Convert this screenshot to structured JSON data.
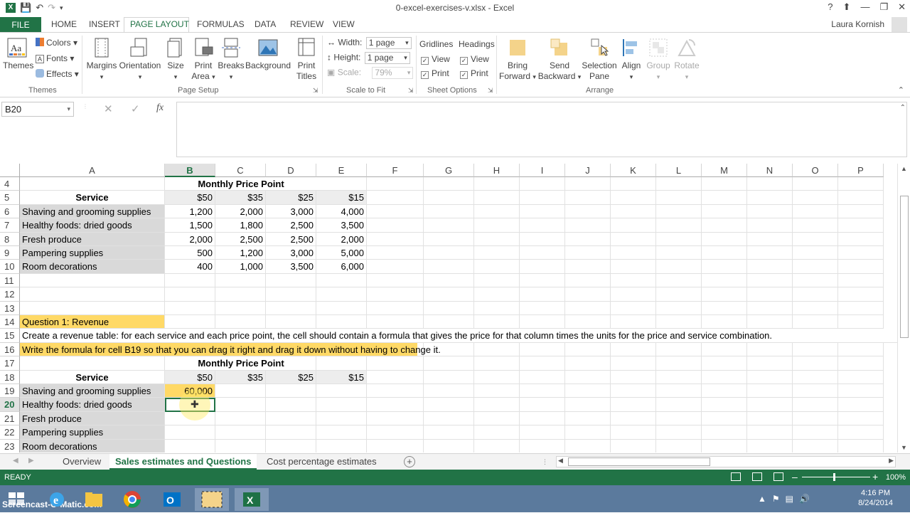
{
  "window": {
    "title": "0-excel-exercises-v.xlsx - Excel",
    "help": "?",
    "user": "Laura Kornish"
  },
  "ribbon_tabs": [
    "FILE",
    "HOME",
    "INSERT",
    "PAGE LAYOUT",
    "FORMULAS",
    "DATA",
    "REVIEW",
    "VIEW"
  ],
  "ribbon": {
    "themes": {
      "themes": "Themes",
      "colors": "Colors",
      "fonts": "Fonts",
      "effects": "Effects",
      "group": "Themes"
    },
    "page_setup": {
      "margins": "Margins",
      "orientation": "Orientation",
      "size": "Size",
      "print_area_1": "Print",
      "print_area_2": "Area",
      "breaks": "Breaks",
      "background": "Background",
      "print_titles_1": "Print",
      "print_titles_2": "Titles",
      "group": "Page Setup"
    },
    "scale_to_fit": {
      "width_label": "Width:",
      "width_value": "1 page",
      "height_label": "Height:",
      "height_value": "1 page",
      "scale_label": "Scale:",
      "scale_value": "79%",
      "group": "Scale to Fit"
    },
    "sheet_options": {
      "gridlines": "Gridlines",
      "headings": "Headings",
      "view": "View",
      "print": "Print",
      "group": "Sheet Options"
    },
    "arrange": {
      "bring_1": "Bring",
      "bring_2": "Forward",
      "send_1": "Send",
      "send_2": "Backward",
      "selection_1": "Selection",
      "selection_2": "Pane",
      "align": "Align",
      "group_btn": "Group",
      "rotate": "Rotate",
      "group": "Arrange"
    }
  },
  "formula_bar": {
    "name_box": "B20",
    "fx": "fx",
    "formula": ""
  },
  "columns": [
    "A",
    "B",
    "C",
    "D",
    "E",
    "F",
    "G",
    "H",
    "I",
    "J",
    "K",
    "L",
    "M",
    "N",
    "O",
    "P"
  ],
  "rows": [
    "4",
    "5",
    "6",
    "7",
    "8",
    "9",
    "10",
    "11",
    "12",
    "13",
    "14",
    "15",
    "16",
    "17",
    "18",
    "19",
    "20",
    "21",
    "22",
    "23"
  ],
  "sheet": {
    "r4_header": "Monthly Price Point",
    "r5_service": "Service",
    "price_points": [
      "$50",
      "$35",
      "$25",
      "$15"
    ],
    "table1": [
      {
        "service": "Shaving and grooming supplies",
        "values": [
          "1,200",
          "2,000",
          "3,000",
          "4,000"
        ]
      },
      {
        "service": "Healthy foods: dried goods",
        "values": [
          "1,500",
          "1,800",
          "2,500",
          "3,500"
        ]
      },
      {
        "service": "Fresh produce",
        "values": [
          "2,000",
          "2,500",
          "2,500",
          "2,000"
        ]
      },
      {
        "service": "Pampering supplies",
        "values": [
          "500",
          "1,200",
          "3,000",
          "5,000"
        ]
      },
      {
        "service": "Room decorations",
        "values": [
          "400",
          "1,000",
          "3,500",
          "6,000"
        ]
      }
    ],
    "q1_title": "Question 1: Revenue",
    "q1_text": "Create a revenue table: for each service and each price point, the cell should contain a formula that gives the price for that column times the units for the price and service combination.",
    "q1_hint": "Write the formula for cell B19 so that you can drag it right and drag it down without having to change it.",
    "r17_header": "Monthly Price Point",
    "r18_service": "Service",
    "table2_services": [
      "Shaving and grooming supplies",
      "Healthy foods: dried goods",
      "Fresh produce",
      "Pampering supplies",
      "Room decorations"
    ],
    "b19_value": "60,000"
  },
  "sheet_tabs": [
    "Overview",
    "Sales estimates and Questions",
    "Cost percentage estimates"
  ],
  "status": {
    "text": "READY",
    "zoom": "100%"
  },
  "taskbar": {
    "watermark": "Screencast-O-Matic.com",
    "time": "4:16 PM",
    "date": "8/24/2014"
  },
  "colors": {
    "excel_green": "#217346",
    "gray_fill": "#d9d9d9",
    "yellow_fill": "#ffd966"
  }
}
